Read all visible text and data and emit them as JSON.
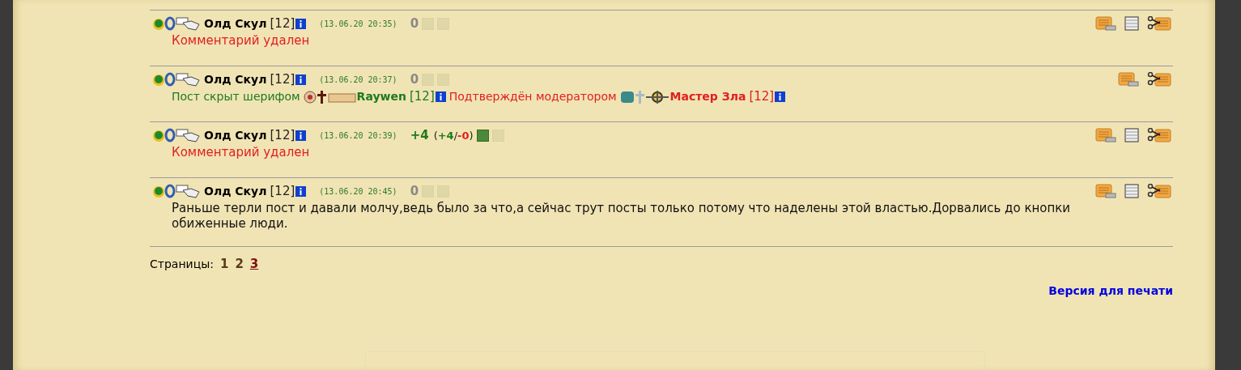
{
  "comments": [
    {
      "author": "Олд Скул",
      "level": "[12]",
      "date": "(13.06.20 20:35)",
      "score": "0",
      "positive": false,
      "plus_enabled": false,
      "minus_enabled": false,
      "actions": [
        {
          "kind": "edit"
        },
        {
          "kind": "history"
        },
        {
          "kind": "cut"
        }
      ],
      "body": {
        "kind": "deleted",
        "text": "Комментарий удален"
      }
    },
    {
      "author": "Олд Скул",
      "level": "[12]",
      "date": "(13.06.20 20:37)",
      "score": "0",
      "positive": false,
      "plus_enabled": false,
      "minus_enabled": false,
      "actions": [
        {
          "kind": "edit"
        },
        {
          "kind": "cut"
        }
      ],
      "body": {
        "kind": "hidden",
        "hidden_label": "Пост скрыт шерифом",
        "hidden_user": "Raywen",
        "hidden_level": "[12]",
        "confirm_label": "Подтверждён модератором",
        "confirm_user": "Мастер Зла",
        "confirm_level": "[12]"
      }
    },
    {
      "author": "Олд Скул",
      "level": "[12]",
      "date": "(13.06.20 20:39)",
      "score": "+4",
      "positive": true,
      "breakdown": {
        "open": "(",
        "plus": "+4",
        "slash": "/",
        "minus": "-0",
        "close": ")"
      },
      "plus_enabled": true,
      "minus_enabled": false,
      "actions": [
        {
          "kind": "edit"
        },
        {
          "kind": "history"
        },
        {
          "kind": "cut"
        }
      ],
      "body": {
        "kind": "deleted",
        "text": "Комментарий удален"
      }
    },
    {
      "author": "Олд Скул",
      "level": "[12]",
      "date": "(13.06.20 20:45)",
      "score": "0",
      "positive": false,
      "plus_enabled": false,
      "minus_enabled": false,
      "actions": [
        {
          "kind": "edit"
        },
        {
          "kind": "history"
        },
        {
          "kind": "cut"
        }
      ],
      "body": {
        "kind": "text",
        "text": "Раньше терли пост и давали молчу,ведь было за что,а сейчас трут посты только потому что наделены этой властью.Дорвались до кнопки обиженные люди."
      }
    }
  ],
  "pagination": {
    "label": "Страницы:",
    "pages": [
      {
        "label": "1",
        "selected": false
      },
      {
        "label": "2",
        "selected": false
      },
      {
        "label": "3",
        "selected": true
      }
    ]
  },
  "print_link": "Версия для печати"
}
